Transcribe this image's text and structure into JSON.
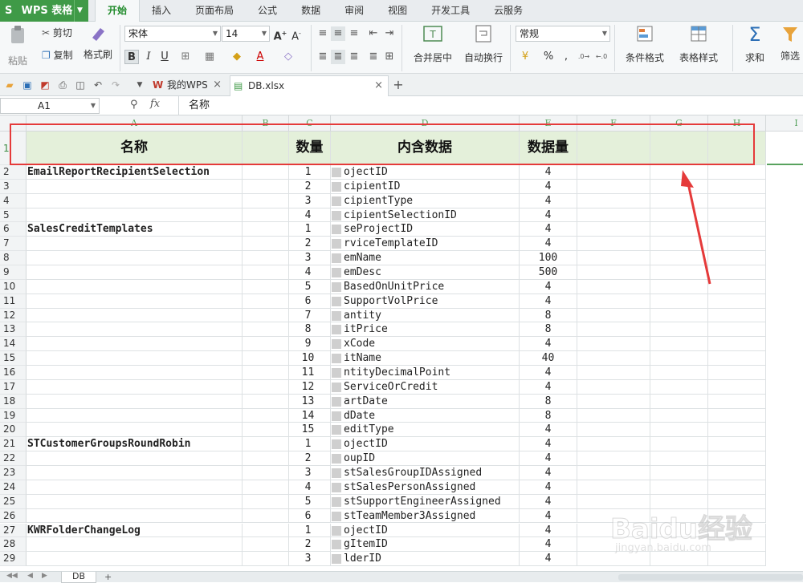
{
  "app": {
    "name": "WPS 表格",
    "logo": "S"
  },
  "ribbon_tabs": [
    "开始",
    "插入",
    "页面布局",
    "公式",
    "数据",
    "审阅",
    "视图",
    "开发工具",
    "云服务"
  ],
  "ribbon": {
    "paste": "粘贴",
    "cut": "剪切",
    "copy": "复制",
    "format_painter": "格式刷",
    "font_name": "宋体",
    "font_size": "14",
    "bold": "B",
    "italic": "I",
    "underline": "U",
    "font_color_glyph": "A",
    "merge_center": "合并居中",
    "wrap_text": "自动换行",
    "number_format": "常规",
    "percent": "%",
    "thousands": ",",
    "conditional_format": "条件格式",
    "table_style": "表格样式",
    "sum": "求和",
    "filter": "筛选"
  },
  "doc_tabs": [
    {
      "label": "我的WPS",
      "active": false
    },
    {
      "label": "DB.xlsx",
      "active": true
    }
  ],
  "formula_bar": {
    "cell_ref": "A1",
    "fx": "fx",
    "value": "名称"
  },
  "columns": [
    "A",
    "B",
    "C",
    "D",
    "E",
    "F",
    "G",
    "H",
    "I"
  ],
  "header_row": {
    "row": "1",
    "name": "名称",
    "count": "数量",
    "content": "内含数据",
    "size": "数据量"
  },
  "rows": [
    {
      "r": "2",
      "name": "EmailReportRecipientSelection",
      "num": "1",
      "data": "ojectID",
      "size": "4"
    },
    {
      "r": "3",
      "name": "",
      "num": "2",
      "data": "cipientID",
      "size": "4"
    },
    {
      "r": "4",
      "name": "",
      "num": "3",
      "data": "cipientType",
      "size": "4"
    },
    {
      "r": "5",
      "name": "",
      "num": "4",
      "data": "cipientSelectionID",
      "size": "4"
    },
    {
      "r": "6",
      "name": "SalesCreditTemplates",
      "num": "1",
      "data": "seProjectID",
      "size": "4"
    },
    {
      "r": "7",
      "name": "",
      "num": "2",
      "data": "rviceTemplateID",
      "size": "4"
    },
    {
      "r": "8",
      "name": "",
      "num": "3",
      "data": "emName",
      "size": "100"
    },
    {
      "r": "9",
      "name": "",
      "num": "4",
      "data": "emDesc",
      "size": "500"
    },
    {
      "r": "10",
      "name": "",
      "num": "5",
      "data": "BasedOnUnitPrice",
      "size": "4"
    },
    {
      "r": "11",
      "name": "",
      "num": "6",
      "data": "SupportVolPrice",
      "size": "4"
    },
    {
      "r": "12",
      "name": "",
      "num": "7",
      "data": "antity",
      "size": "8"
    },
    {
      "r": "13",
      "name": "",
      "num": "8",
      "data": "itPrice",
      "size": "8"
    },
    {
      "r": "14",
      "name": "",
      "num": "9",
      "data": "xCode",
      "size": "4"
    },
    {
      "r": "15",
      "name": "",
      "num": "10",
      "data": "itName",
      "size": "40"
    },
    {
      "r": "16",
      "name": "",
      "num": "11",
      "data": "ntityDecimalPoint",
      "size": "4"
    },
    {
      "r": "17",
      "name": "",
      "num": "12",
      "data": "ServiceOrCredit",
      "size": "4"
    },
    {
      "r": "18",
      "name": "",
      "num": "13",
      "data": "artDate",
      "size": "8"
    },
    {
      "r": "19",
      "name": "",
      "num": "14",
      "data": "dDate",
      "size": "8"
    },
    {
      "r": "20",
      "name": "",
      "num": "15",
      "data": "editType",
      "size": "4"
    },
    {
      "r": "21",
      "name": "STCustomerGroupsRoundRobin",
      "num": "1",
      "data": "ojectID",
      "size": "4"
    },
    {
      "r": "22",
      "name": "",
      "num": "2",
      "data": "oupID",
      "size": "4"
    },
    {
      "r": "23",
      "name": "",
      "num": "3",
      "data": "stSalesGroupIDAssigned",
      "size": "4"
    },
    {
      "r": "24",
      "name": "",
      "num": "4",
      "data": "stSalesPersonAssigned",
      "size": "4"
    },
    {
      "r": "25",
      "name": "",
      "num": "5",
      "data": "stSupportEngineerAssigned",
      "size": "4"
    },
    {
      "r": "26",
      "name": "",
      "num": "6",
      "data": "stTeamMember3Assigned",
      "size": "4"
    },
    {
      "r": "27",
      "name": "KWRFolderChangeLog",
      "num": "1",
      "data": "ojectID",
      "size": "4"
    },
    {
      "r": "28",
      "name": "",
      "num": "2",
      "data": "gItemID",
      "size": "4"
    },
    {
      "r": "29",
      "name": "",
      "num": "3",
      "data": "lderID",
      "size": "4"
    }
  ],
  "sheet_tab": "DB",
  "annotation_color": "#e53a3a",
  "accent_color": "#3f9a47",
  "watermark": {
    "brand": "Bai经验",
    "url": "jingyan.baidu.com"
  }
}
